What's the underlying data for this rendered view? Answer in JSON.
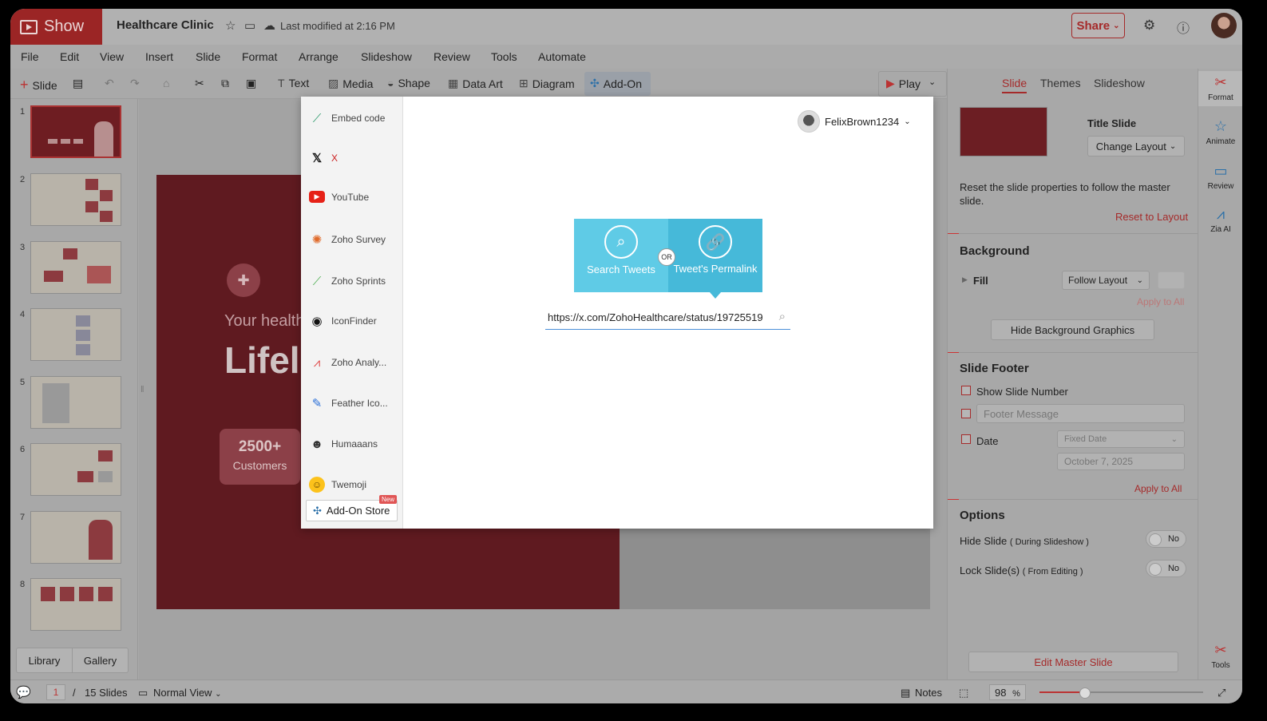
{
  "app": {
    "name": "Show",
    "doc_title": "Healthcare Clinic",
    "modified": "Last modified at 2:16 PM",
    "share": "Share"
  },
  "menu": [
    "File",
    "Edit",
    "View",
    "Insert",
    "Slide",
    "Format",
    "Arrange",
    "Slideshow",
    "Review",
    "Tools",
    "Automate"
  ],
  "toolbar": {
    "slide": "Slide",
    "text": "Text",
    "media": "Media",
    "shape": "Shape",
    "data_art": "Data Art",
    "diagram": "Diagram",
    "addon": "Add-On",
    "play": "Play"
  },
  "slides_panel": {
    "numbers": [
      "1",
      "2",
      "3",
      "4",
      "5",
      "6",
      "7",
      "8"
    ],
    "library": "Library",
    "gallery": "Gallery"
  },
  "slide": {
    "tagline": "Your health",
    "title": "Lifeli",
    "stat_number": "2500+",
    "stat_label": "Customers"
  },
  "addon_modal": {
    "items": [
      "Embed code",
      "X",
      "YouTube",
      "Zoho Survey",
      "Zoho Sprints",
      "IconFinder",
      "Zoho Analy...",
      "Feather Ico...",
      "Humaaans",
      "Twemoji"
    ],
    "store": "Add-On Store",
    "store_badge": "New",
    "user": "FelixBrown1234",
    "search_tweets": "Search Tweets",
    "or": "OR",
    "permalink": "Tweet's Permalink",
    "url_value": "https://x.com/ZohoHealthcare/status/19725519"
  },
  "right_panel": {
    "tabs": [
      "Slide",
      "Themes",
      "Slideshow"
    ],
    "layout_name": "Title Slide",
    "change_layout": "Change Layout",
    "reset_desc": "Reset the slide properties to follow the master slide.",
    "reset_link": "Reset to Layout",
    "background": "Background",
    "fill": "Fill",
    "fill_value": "Follow Layout",
    "apply_all_disabled": "Apply to All",
    "hide_bg": "Hide Background Graphics",
    "footer": "Slide Footer",
    "show_number": "Show Slide Number",
    "footer_placeholder": "Footer Message",
    "date": "Date",
    "date_type": "Fixed Date",
    "date_value": "October 7, 2025",
    "apply_all": "Apply to All",
    "options": "Options",
    "hide_slide": "Hide Slide",
    "hide_slide_note": "( During Slideshow )",
    "lock_slide": "Lock Slide(s)",
    "lock_slide_note": "( From Editing )",
    "toggle_no": "No",
    "edit_master": "Edit Master Slide"
  },
  "icon_bar": [
    "Format",
    "Animate",
    "Review",
    "Zia AI",
    "Tools"
  ],
  "status": {
    "page": "1",
    "sep": "/",
    "total": "15 Slides",
    "view": "Normal View",
    "notes": "Notes",
    "zoom": "98",
    "pct": "%"
  },
  "colors": {
    "brand": "#9b2525",
    "accent": "#a52a2a",
    "tweet_blue": "#5fcbe6"
  }
}
